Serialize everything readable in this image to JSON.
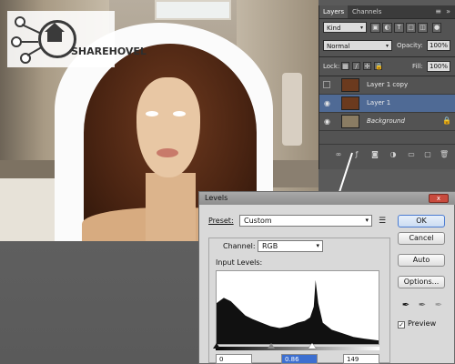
{
  "watermark": {
    "brand": "SHAREHOVEL"
  },
  "layers_panel": {
    "tabs": [
      {
        "label": "Layers"
      },
      {
        "label": "Channels"
      }
    ],
    "kind_filter": "Kind",
    "blend_mode": "Normal",
    "opacity_label": "Opacity:",
    "opacity_value": "100%",
    "lock_label": "Lock:",
    "fill_label": "Fill:",
    "fill_value": "100%",
    "layers": [
      {
        "name": "Layer 1 copy",
        "visible": false,
        "selected": false,
        "italic": false
      },
      {
        "name": "Layer 1",
        "visible": true,
        "selected": true,
        "italic": false
      },
      {
        "name": "Background",
        "visible": true,
        "selected": false,
        "italic": true,
        "locked": true
      }
    ]
  },
  "levels_dialog": {
    "title": "Levels",
    "close_label": "x",
    "preset_label": "Preset:",
    "preset_value": "Custom",
    "channel_label": "Channel:",
    "channel_value": "RGB",
    "input_levels_label": "Input Levels:",
    "input_black": "0",
    "input_gamma": "0.86",
    "input_white": "149",
    "buttons": {
      "ok": "OK",
      "cancel": "Cancel",
      "auto": "Auto",
      "options": "Options..."
    },
    "preview_label": "Preview",
    "preview_checked": true
  },
  "colors": {
    "selected_layer": "#4f6a95",
    "dialog_bg": "#d9d9d9",
    "panel_bg": "#535353"
  }
}
